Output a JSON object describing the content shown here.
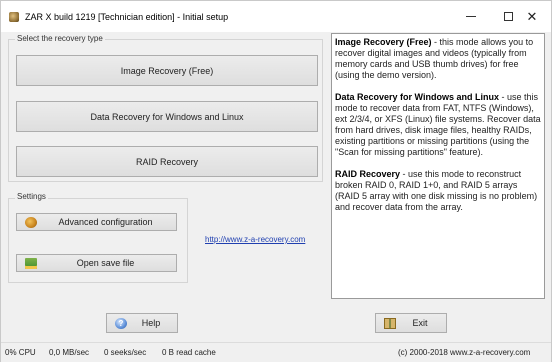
{
  "window": {
    "title": "ZAR X build 1219 [Technician edition] - Initial setup",
    "controls": {
      "minimize": "–",
      "maximize": "☐",
      "close": "✕"
    }
  },
  "recovery_group": {
    "label": "Select the recovery type",
    "buttons": [
      "Image Recovery (Free)",
      "Data Recovery for Windows and Linux",
      "RAID Recovery"
    ]
  },
  "settings_group": {
    "label": "Settings",
    "advanced_label": "Advanced configuration",
    "open_save_label": "Open save file"
  },
  "link": "http://www.z-a-recovery.com",
  "info": {
    "image_title": "Image Recovery (Free)",
    "image_text": " - this mode allows you to recover digital images and videos (typically from memory cards and USB thumb drives) for free (using the demo version).",
    "data_title": "Data Recovery for Windows and Linux",
    "data_text": " - use this mode to recover data from FAT, NTFS (Windows), ext 2/3/4, or XFS (Linux) file systems. Recover data from hard drives, disk image files, healthy RAIDs, existing partitions or missing partitions (using the \"Scan for missing partitions\" feature).",
    "raid_title": "RAID Recovery",
    "raid_text": " - use this mode to reconstruct broken RAID 0, RAID 1+0, and RAID 5 arrays (RAID 5 array with one disk missing is no problem) and recover data from the array."
  },
  "bottom": {
    "help_label": "Help",
    "exit_label": "Exit"
  },
  "status": {
    "cpu": "0% CPU",
    "throughput": "0,0 MB/sec",
    "seeks": "0 seeks/sec",
    "cache": "0 B read cache",
    "copyright": "(c) 2000-2018 www.z-a-recovery.com"
  },
  "icons": {
    "app": "zar-app-icon",
    "advanced": "gear-icon",
    "open_save": "folder-icon",
    "help": "help-icon",
    "exit": "exit-door-icon"
  }
}
